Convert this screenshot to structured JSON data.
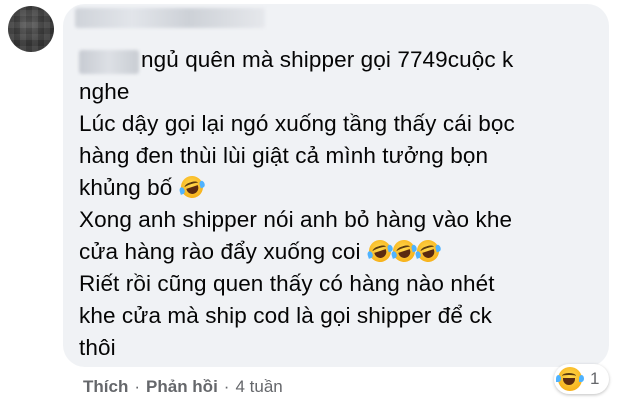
{
  "comment": {
    "lines": [
      "ngủ quên mà shipper gọi 7749cuộc k",
      "nghe",
      "Lúc dậy gọi lại ngó xuống tầng thấy cái bọc",
      "hàng đen thùi lùi giật cả mình tưởng bọn",
      "khủng bố",
      "Xong anh shipper nói anh bỏ hàng vào khe",
      "cửa hàng rào đẩy xuống coi",
      "Riết rồi cũng quen thấy có hàng nào nhét",
      "khe cửa mà ship cod là gọi shipper để ck",
      "thôi"
    ],
    "emoji_name": "rolling-on-floor-laughing-emoji"
  },
  "actions": {
    "like": "Thích",
    "separator": "·",
    "reply": "Phản hồi",
    "time": "4 tuần"
  },
  "reaction": {
    "emoji_name": "laughing-emoji",
    "count": "1"
  }
}
